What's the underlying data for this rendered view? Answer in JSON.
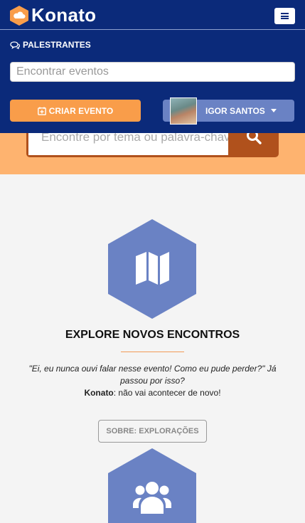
{
  "header": {
    "brand": "Konato",
    "nav_link": "PALESTRANTES",
    "search_placeholder": "Encontrar eventos",
    "create_button": "CRIAR EVENTO",
    "user_name": "IGOR SANTOS"
  },
  "hero": {
    "search_placeholder": "Encontre por tema ou palavra-chave"
  },
  "feature": {
    "title": "EXPLORE NOVOS ENCONTROS",
    "quote": "\"Ei, eu nunca ouvi falar nesse evento! Como eu pude perder?\" Já passou por isso?",
    "brand_bold": "Konato",
    "tail": ": não vai acontecer de novo!",
    "about_button": "SOBRE: EXPLORAÇÕES"
  },
  "colors": {
    "navbar": "#0b2a7a",
    "orange": "#f99d4a",
    "hero": "#feb36f",
    "hex": "#6a82c4"
  }
}
